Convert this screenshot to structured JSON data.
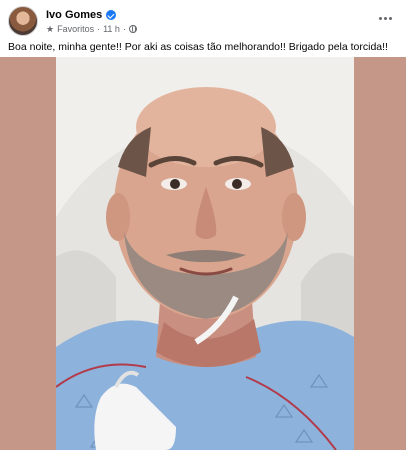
{
  "post": {
    "author": "Ivo Gomes",
    "audience": "Favoritos",
    "time": "11 h",
    "caption": "Boa noite, minha gente!! Por aki as coisas tão melhorando!! Brigado pela torcida!!"
  },
  "icons": {
    "verified": "verified-badge-icon",
    "favorites": "star-icon",
    "privacy": "globe-icon",
    "more": "more-options-icon"
  },
  "colors": {
    "verified_blue": "#1877f2",
    "meta_gray": "#65676b",
    "photo_backdrop": "#c59789"
  }
}
